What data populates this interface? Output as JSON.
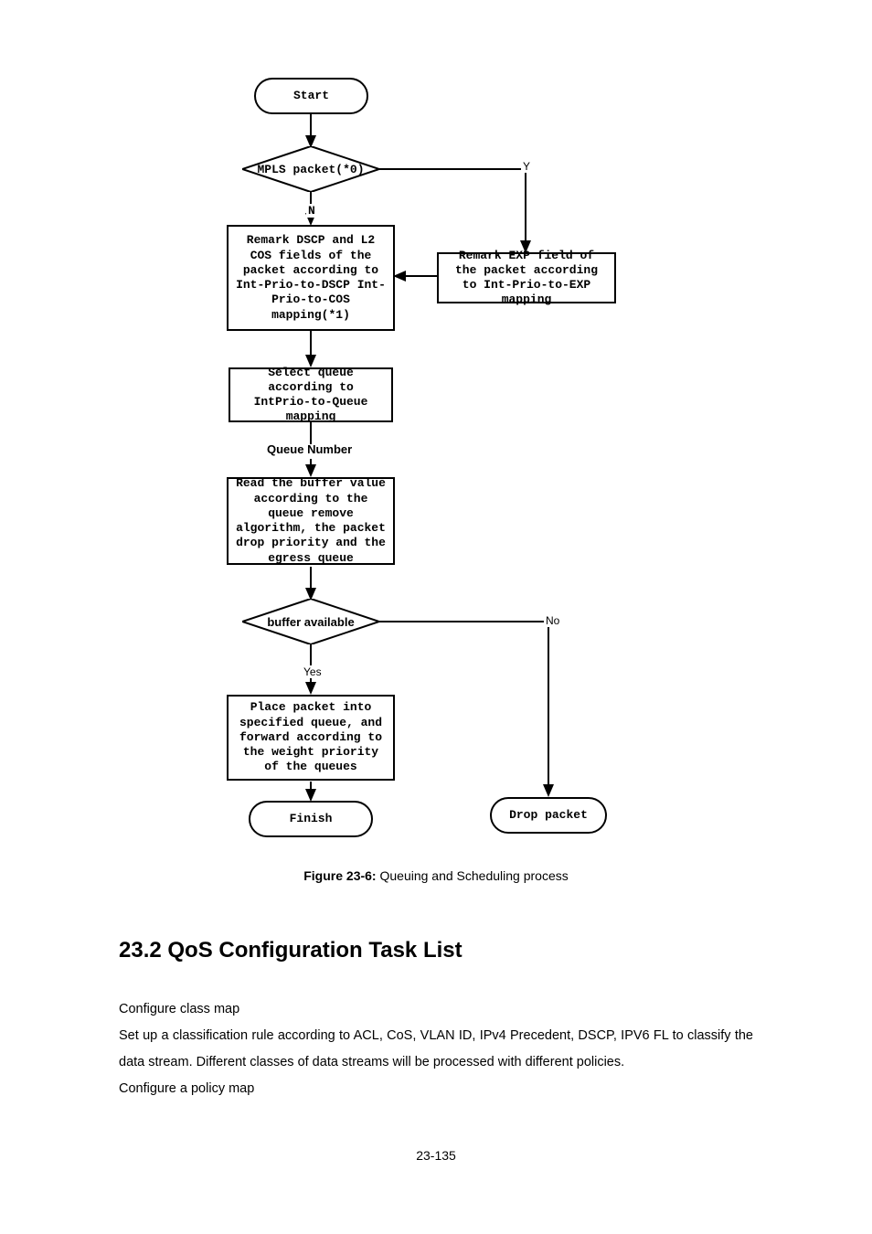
{
  "diagram": {
    "start": "Start",
    "d1": "MPLS packet(*0)",
    "d1_y": "Y",
    "d1_n": "N",
    "box_remark_dscp": "Remark DSCP and L2 COS fields of the packet according to Int-Prio-to-DSCP Int-Prio-to-COS mapping(*1)",
    "box_remark_exp": "Remark EXP field of the packet according to Int-Prio-to-EXP mapping",
    "box_select_queue": "Select queue according to IntPrio-to-Queue mapping",
    "queue_number": "Queue Number",
    "box_read_buffer": "Read the buffer value according to the queue remove algorithm, the packet drop priority and the egress queue",
    "d2": "buffer available",
    "d2_yes": "Yes",
    "d2_no": "No",
    "box_place_packet": "Place packet into specified queue, and forward according to the weight priority of the queues",
    "finish": "Finish",
    "drop": "Drop packet"
  },
  "caption": {
    "label": "Figure 23-6:",
    "text": " Queuing and Scheduling process"
  },
  "heading": "23.2 QoS Configuration Task List",
  "body": {
    "p1": "Configure class map",
    "p2": "Set up a classification rule according to ACL, CoS, VLAN ID, IPv4 Precedent, DSCP, IPV6 FL to classify the data stream. Different classes of data streams will be processed with different policies.",
    "p3": "Configure a policy map"
  },
  "footer": "23-135"
}
